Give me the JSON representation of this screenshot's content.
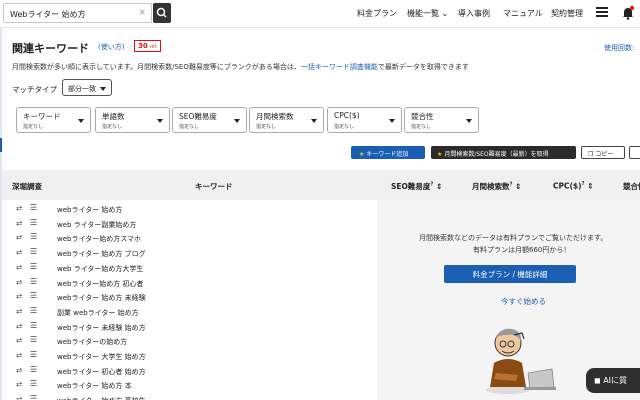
{
  "search": {
    "value": "Webライター 始め方",
    "clear": "×"
  },
  "nav": {
    "items": [
      "料金プラン",
      "機能一覧",
      "導入事例",
      "マニュアル",
      "契約管理"
    ],
    "features_chevron": "⌄"
  },
  "page": {
    "title": "関連キーワード",
    "howto": "(使い方)",
    "credit_value": "30",
    "credit_unit": "HIT",
    "used_label": "使用回数:",
    "desc_before": "月間検索数が多い順に表示しています。月間検索数/SEO難易度等にブランクがある場合は、",
    "desc_link": "一括キーワード調査機能",
    "desc_after": "で最新データを取得できます"
  },
  "match": {
    "label": "マッチタイプ",
    "value": "部分一致"
  },
  "filters": [
    {
      "label": "キーワード",
      "sub": "指定なし"
    },
    {
      "label": "単語数",
      "sub": "指定なし"
    },
    {
      "label": "SEO難易度",
      "sub": "指定なし"
    },
    {
      "label": "月間検索数",
      "sub": "指定なし"
    },
    {
      "label": "CPC($)",
      "sub": "指定なし"
    },
    {
      "label": "競合性",
      "sub": "指定なし"
    }
  ],
  "actions": {
    "add_keyword": "キーワード追加",
    "get_data": "月間検索数/SEO難易度（最新）を取得",
    "copy": "コピー"
  },
  "table": {
    "headers": {
      "deep": "深堀調査",
      "keyword": "キーワード",
      "seo": "SEO難易度",
      "volume": "月間検索数",
      "cpc": "CPC($)",
      "competition": "競合性"
    },
    "help_mark": "?",
    "sort_mark": "⇕",
    "rows": [
      "webライター 始め方",
      "web ライター副業始め方",
      "webライター始め方スマホ",
      "webライター 始め方 ブログ",
      "web ライター始め方大学生",
      "webライター始め方 初心者",
      "webライター 始め方 未経験",
      "副業 webライター 始め方",
      "webライター 未経験 始め方",
      "webライターの始め方",
      "webライター 大学生 始め方",
      "webライター 初心者 始め方",
      "webライター 始め方 本",
      "webライター 始め方 高校生"
    ]
  },
  "paid": {
    "line1": "月間検索数などのデータは有料プランでご覧いただけます。",
    "line2": "有料プランは月額660円から！",
    "button": "料金プラン / 機能詳細",
    "try_link": "今すぐ始める"
  },
  "ai_button": {
    "label": "AIに質"
  },
  "colors": {
    "accent": "#1a5fb4",
    "dark": "#2b2b2b",
    "credit": "#dd1111"
  }
}
